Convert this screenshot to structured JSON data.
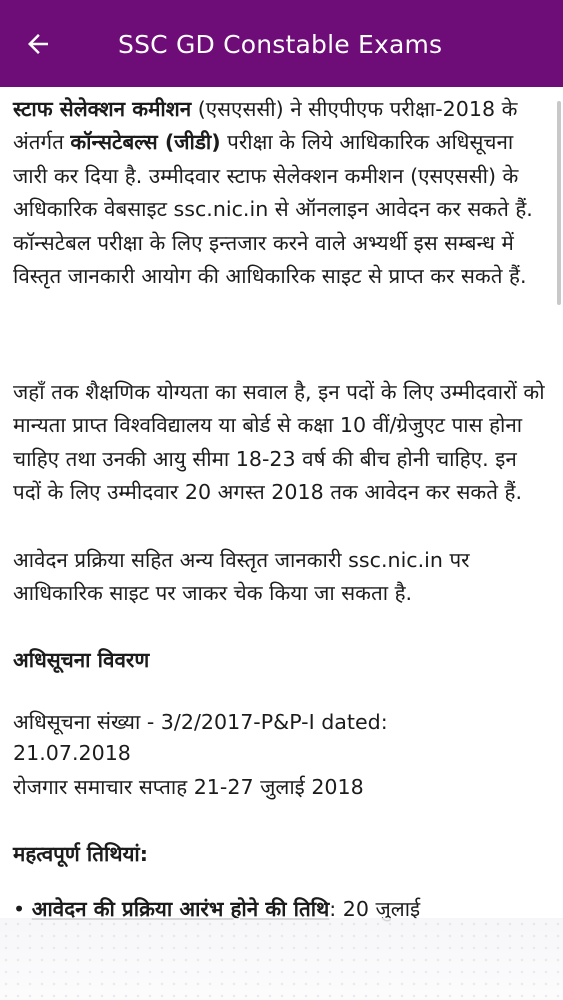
{
  "appbar": {
    "title": "SSC GD Constable Exams",
    "back_icon": "arrow-left-icon",
    "color": "#6e0c78"
  },
  "article": {
    "p1": {
      "s1_bold": "स्टाफ सेलेक्शन कमीशन",
      "s2": " (एसएससी) ने सीएपीएफ परीक्षा-2018 के अंतर्गत ",
      "s3_bold": "कॉन्सटेबल्स (जीडी)",
      "s4": " परीक्षा के लिये आधिकारिक अधिसूचना जारी कर दिया है. उम्मीदवार स्टाफ सेलेक्शन कमीशन (एसएससी) के अधिकारिक वेबसाइट ssc.nic.in से ऑनलाइन आवेदन कर सकते हैं. कॉन्सटेबल परीक्षा के लिए इन्तजार करने वाले अभ्यर्थी इस सम्बन्ध में विस्तृत जानकारी आयोग की आधिकारिक साइट से प्राप्त कर सकते हैं."
    },
    "p2": "जहाँ तक शैक्षणिक योग्यता का सवाल है, इन पदों के लिए उम्मीदवारों को मान्यता प्राप्त विश्वविद्यालय या बोर्ड से कक्षा 10 वीं/ग्रेजुएट पास होना चाहिए तथा उनकी आयु सीमा 18-23 वर्ष की बीच होनी चाहिए. इन पदों के लिए उम्मीदवार 20 अगस्त 2018 तक आवेदन कर सकते हैं.",
    "p3": "आवेदन प्रक्रिया सहित अन्य विस्तृत जानकारी ssc.nic.in पर आधिकारिक साइट पर जाकर चेक किया जा सकता है.",
    "notification_heading": "अधिसूचना विवरण",
    "notification_line1": "अधिसूचना संख्या - 3/2/2017-P&P-I dated:",
    "notification_line2": "21.07.2018",
    "notification_line3": "रोजगार समाचार सप्ताह 21-27 जुलाई 2018",
    "dates_heading": "महत्वपूर्ण तिथियां:",
    "bullet_label": "आवेदन की प्रक्रिया आरंभ होने की तिथि",
    "bullet_value": ": 20 जुलाई"
  }
}
